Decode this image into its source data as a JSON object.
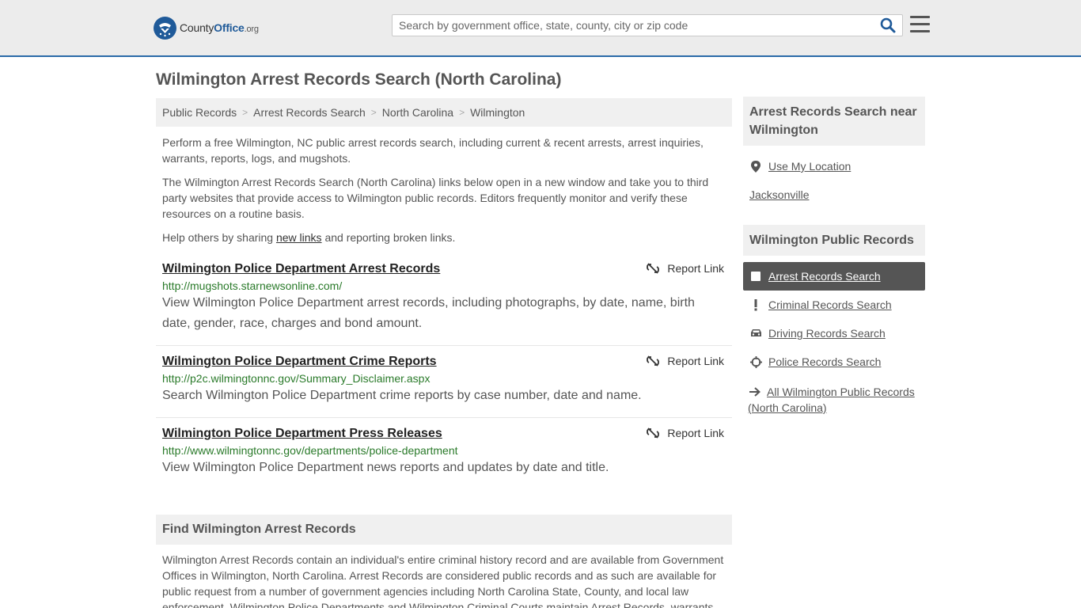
{
  "header": {
    "logo_county": "County",
    "logo_office": "Office",
    "logo_org": ".org",
    "search_placeholder": "Search by government office, state, county, city or zip code"
  },
  "page_title": "Wilmington Arrest Records Search (North Carolina)",
  "breadcrumb": [
    "Public Records",
    "Arrest Records Search",
    "North Carolina",
    "Wilmington"
  ],
  "intro": {
    "p1": "Perform a free Wilmington, NC public arrest records search, including current & recent arrests, arrest inquiries, warrants, reports, logs, and mugshots.",
    "p2": "The Wilmington Arrest Records Search (North Carolina) links below open in a new window and take you to third party websites that provide access to Wilmington public records. Editors frequently monitor and verify these resources on a routine basis.",
    "p3_before": "Help others by sharing ",
    "p3_link": "new links",
    "p3_after": " and reporting broken links."
  },
  "report_link_label": "Report Link",
  "records": [
    {
      "title": "Wilmington Police Department Arrest Records",
      "url": "http://mugshots.starnewsonline.com/",
      "desc": "View Wilmington Police Department arrest records, including photographs, by date, name, birth date, gender, race, charges and bond amount."
    },
    {
      "title": "Wilmington Police Department Crime Reports",
      "url": "http://p2c.wilmingtonnc.gov/Summary_Disclaimer.aspx",
      "desc": "Search Wilmington Police Department crime reports by case number, date and name."
    },
    {
      "title": "Wilmington Police Department Press Releases",
      "url": "http://www.wilmingtonnc.gov/departments/police-department",
      "desc": "View Wilmington Police Department news reports and updates by date and title."
    }
  ],
  "find": {
    "title": "Find Wilmington Arrest Records",
    "text": "Wilmington Arrest Records contain an individual's entire criminal history record and are available from Government Offices in Wilmington, North Carolina. Arrest Records are considered public records and as such are available for public request from a number of government agencies including North Carolina State, County, and local law enforcement. Wilmington Police Departments and Wilmington Criminal Courts maintain Arrest Records, warrants"
  },
  "sidebar": {
    "near_title": "Arrest Records Search near Wilmington",
    "use_location": "Use My Location",
    "near_city": "Jacksonville",
    "public_title": "Wilmington Public Records",
    "links": {
      "arrest": "Arrest Records Search",
      "criminal": "Criminal Records Search",
      "driving": "Driving Records Search",
      "police": "Police Records Search",
      "all": "All Wilmington Public Records (North Carolina)"
    }
  },
  "colors": {
    "brand_blue": "#1f5a99",
    "url_green": "#2a7a2a",
    "active_bg": "#555555"
  }
}
